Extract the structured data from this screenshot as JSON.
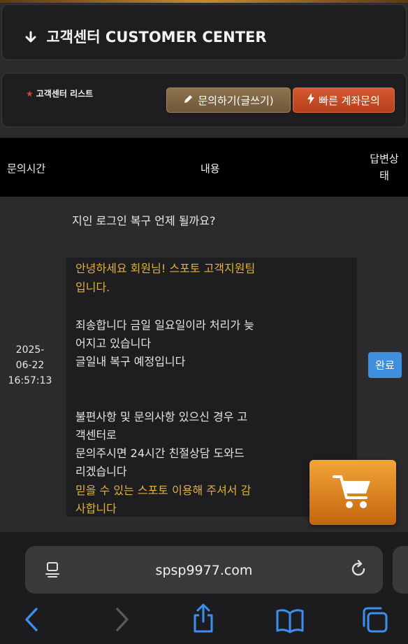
{
  "header": {
    "arrow": "➜",
    "title": "고객센터 CUSTOMER CENTER"
  },
  "toolbar": {
    "list_title": "고객센터 리스트",
    "write_label": "문의하기(글쓰기)",
    "fast_label": "빠른 계좌문의"
  },
  "table": {
    "col_time": "문의시간",
    "col_content": "내용",
    "col_status": "답변상태"
  },
  "row": {
    "question": "지인 로그인 복구 언제 될까요?",
    "date_lines": [
      "2025-",
      "06-22",
      "16:57:13"
    ],
    "answer_lines": [
      "안녕하세요 회원님! 스포토 고객지원팀",
      "입니다.",
      "죄송합니다 금일 일요일이라 처리가 늦",
      "어지고 있습니다",
      "글일내 복구 예정입니다",
      "불편사항 및 문의사항 있으신 경우 고",
      "객센터로",
      "문의주시면 24시간 친절상담 도와드",
      "리겠습니다",
      "믿을 수 있는 스포토 이용해 주셔서 감",
      "사합니다"
    ],
    "status": "완료"
  },
  "browser": {
    "url": "spsp9977.com"
  },
  "colors": {
    "accent_gold": "#e0b23a",
    "status_blue": "#3e8fe0",
    "cart_orange": "#e08a24"
  }
}
